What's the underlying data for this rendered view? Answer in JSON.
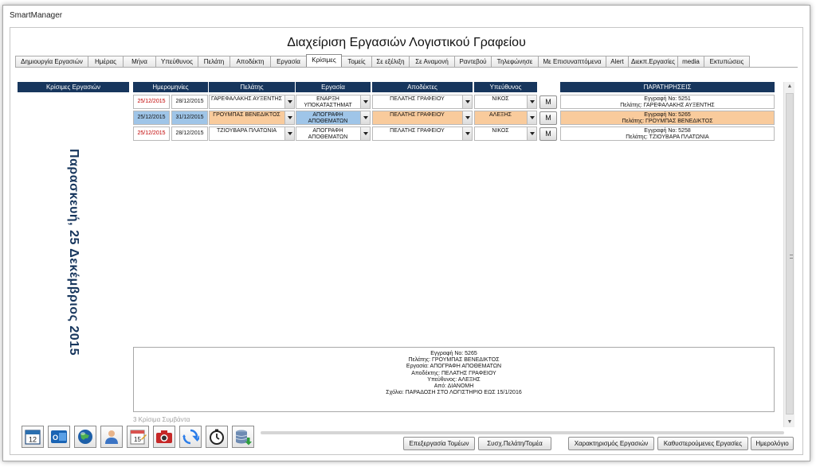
{
  "window": {
    "title": "SmartManager"
  },
  "app": {
    "title": "Διαχείριση Εργασιών Λογιστικού Γραφείου"
  },
  "tabs": [
    {
      "label": "Δημιουργία Εργασιών"
    },
    {
      "label": "Ημέρας"
    },
    {
      "label": "Μήνα"
    },
    {
      "label": "Υπεύθυνος"
    },
    {
      "label": "Πελάτη"
    },
    {
      "label": "Αποδέκτη"
    },
    {
      "label": "Εργασία"
    },
    {
      "label": "Κρίσιμες"
    },
    {
      "label": "Τομείς"
    },
    {
      "label": "Σε εξέλιξη"
    },
    {
      "label": "Σε Αναμονή"
    },
    {
      "label": "Ραντεβού"
    },
    {
      "label": "Τηλεφώνησε"
    },
    {
      "label": "Με Επισυναπτόμενα"
    },
    {
      "label": "Alert"
    },
    {
      "label": "Διεκπ.Εργασίες"
    },
    {
      "label": "media"
    },
    {
      "label": "Εκτυπώσεις"
    }
  ],
  "active_tab": "Κρίσιμες",
  "side_panel": {
    "header": "Κρίσιμες Εργασιών",
    "date_text": "Παρασκευή, 25 Δεκέμβριος 2015"
  },
  "columns": {
    "dates": "Ημερομηνίες",
    "client": "Πελάτης",
    "task": "Εργασία",
    "recipients": "Αποδέκτες",
    "responsible": "Υπεύθυνος",
    "remarks": "ΠΑΡΑΤΗΡΗΣΕΙΣ"
  },
  "rows": [
    {
      "date1": "25/12/2015",
      "date2": "28/12/2015",
      "client": "ΓΑΡΕΦΑΛΑΚΗΣ ΑΥΞΕΝΤΗΣ",
      "task": "ΕΝΑΡΞΗ ΥΠΟΚΑΤΑΣΤΗΜΑΤ",
      "recipient": "ΠΕΛΑΤΗΣ ΓΡΑΦΕΙΟΥ",
      "responsible": "ΝΙΚΟΣ",
      "m_label": "M",
      "remark1": "Εγγραφή Νο: 5251",
      "remark2": "Πελάτης: ΓΑΡΕΦΑΛΑΚΗΣ ΑΥΞΕΝΤΗΣ",
      "selected": false
    },
    {
      "date1": "25/12/2015",
      "date2": "31/12/2015",
      "client": "ΓΡΟΥΜΠΑΣ ΒΕΝΕΔΙΚΤΟΣ",
      "task": "ΑΠΟΓΡΑΦΗ ΑΠΟΘΕΜΑΤΩΝ",
      "recipient": "ΠΕΛΑΤΗΣ ΓΡΑΦΕΙΟΥ",
      "responsible": "ΑΛΕΞΗΣ",
      "m_label": "M",
      "remark1": "Εγγραφή Νο: 5265",
      "remark2": "Πελάτης: ΓΡΟΥΜΠΑΣ ΒΕΝΕΔΙΚΤΟΣ",
      "selected": true
    },
    {
      "date1": "25/12/2015",
      "date2": "28/12/2015",
      "client": "ΤΖΙΟΥΒΑΡΑ ΠΛΑΤΩΝΙΑ",
      "task": "ΑΠΟΓΡΑΦΗ ΑΠΟΘΕΜΑΤΩΝ",
      "recipient": "ΠΕΛΑΤΗΣ ΓΡΑΦΕΙΟΥ",
      "responsible": "ΝΙΚΟΣ",
      "m_label": "M",
      "remark1": "Εγγραφή Νο: 5258",
      "remark2": "Πελάτης: ΤΖΙΟΥΒΑΡΑ ΠΛΑΤΩΝΙΑ",
      "selected": false
    }
  ],
  "detail": {
    "lines": [
      "Εγγραφή Νο: 5265",
      "Πελάτης: ΓΡΟΥΜΠΑΣ ΒΕΝΕΔΙΚΤΟΣ",
      "Εργασία: ΑΠΟΓΡΑΦΗ ΑΠΟΘΕΜΑΤΩΝ",
      "Αποδέκτης: ΠΕΛΑΤΗΣ ΓΡΑΦΕΙΟΥ",
      "Υπεύθυνος: ΑΛΕΞΗΣ",
      "Από: ΔΙΑΝΟΜΗ",
      "Σχόλιο: ΠΑΡΑΔΟΣΗ ΣΤΟ ΛΟΓΙΣΤΗΡΙΟ ΕΩΣ 15/1/2016"
    ]
  },
  "events_count": "3 Κρίσιμα Συμβάντα",
  "toolbar_icons": [
    {
      "name": "calendar-12-icon",
      "text": "12"
    },
    {
      "name": "outlook-icon",
      "text": "O"
    },
    {
      "name": "globe-icon"
    },
    {
      "name": "user-icon"
    },
    {
      "name": "calendar-15-icon",
      "text": "15"
    },
    {
      "name": "camera-icon"
    },
    {
      "name": "sync-icon"
    },
    {
      "name": "timer-icon"
    },
    {
      "name": "database-icon"
    }
  ],
  "buttons": {
    "edit_sectors": "Επεξεργασία Τομέων",
    "link_client_sector": "Συσχ.Πελάτη/Τομέα",
    "task_tagging": "Χαρακτηρισμός Εργασιών",
    "late_tasks": "Καθυστερούμενες Εργασίες",
    "calendar": "Ημερολόγιο"
  },
  "colors": {
    "header_navy": "#17365d",
    "date_red": "#c00000",
    "selected_blue": "#9fc5e8",
    "selected_orange": "#f9cb9c"
  }
}
